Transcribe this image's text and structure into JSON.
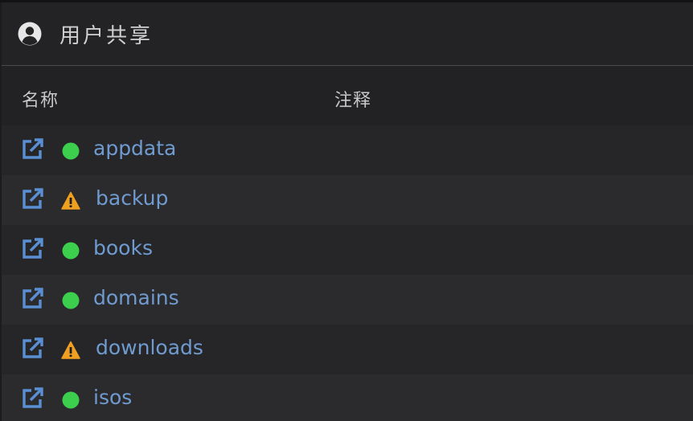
{
  "header": {
    "title": "用户共享",
    "icon": "user-circle-icon"
  },
  "columns": {
    "name": "名称",
    "comment": "注释"
  },
  "shares": [
    {
      "name": "appdata",
      "status": "ok",
      "comment": ""
    },
    {
      "name": "backup",
      "status": "warning",
      "comment": ""
    },
    {
      "name": "books",
      "status": "ok",
      "comment": ""
    },
    {
      "name": "domains",
      "status": "ok",
      "comment": ""
    },
    {
      "name": "downloads",
      "status": "warning",
      "comment": ""
    },
    {
      "name": "isos",
      "status": "ok",
      "comment": ""
    }
  ],
  "colors": {
    "link": "#6f9bd0",
    "ok": "#3ccf4e",
    "warning": "#f0a020",
    "icon": "#5b8fd4"
  }
}
